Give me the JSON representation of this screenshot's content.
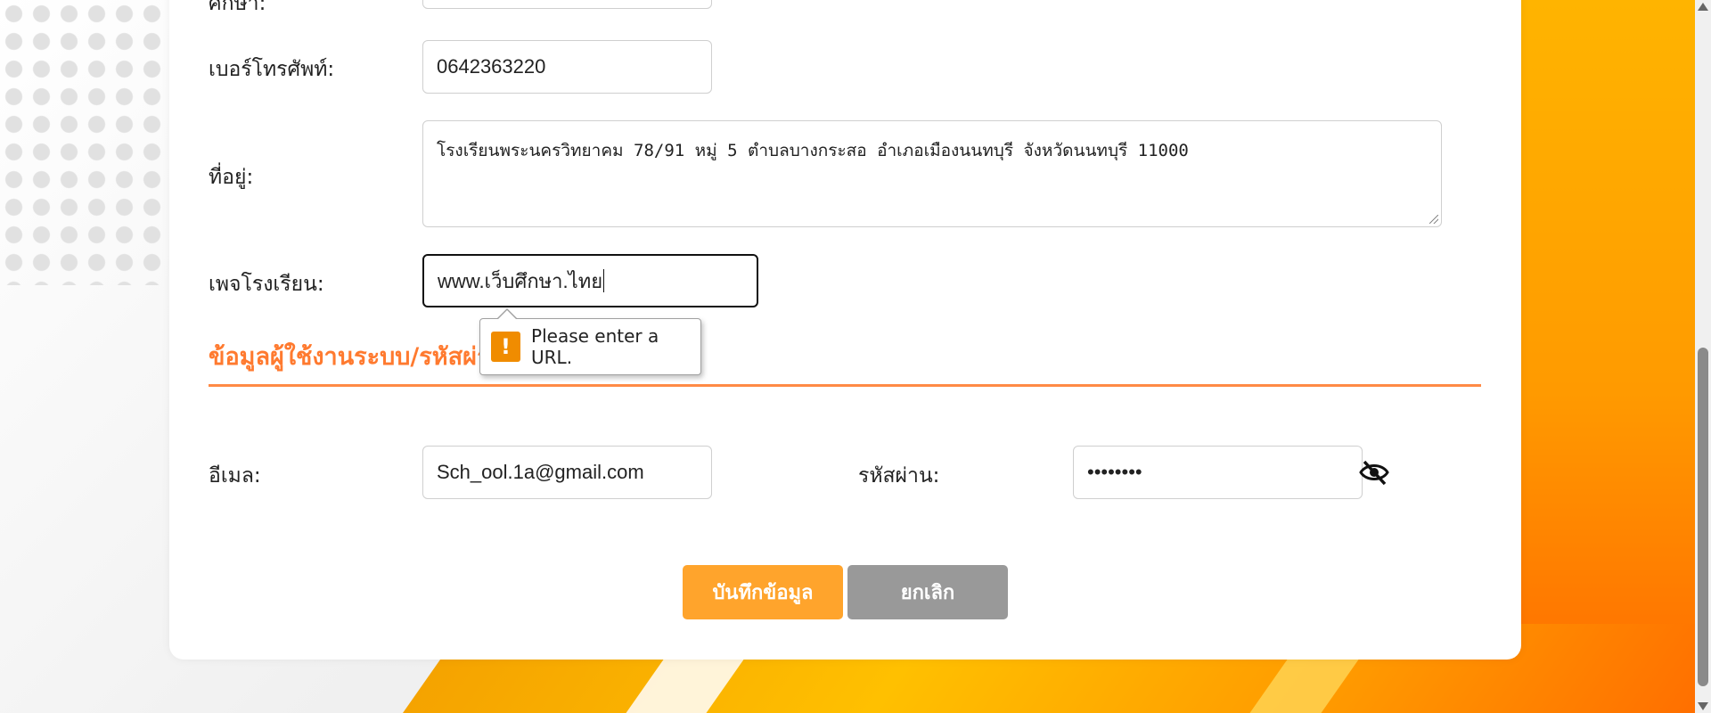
{
  "form": {
    "partial_label_top": "ศึกษา:",
    "phone": {
      "label": "เบอร์โทรศัพท์:",
      "value": "0642363220"
    },
    "address": {
      "label": "ที่อยู่:",
      "value": "โรงเรียนพระนครวิทยาคม 78/91 หมู่ 5 ตำบลบางกระสอ อำเภอเมืองนนทบุรี จังหวัดนนทบุรี 11000"
    },
    "school_page": {
      "label": "เพจโรงเรียน:",
      "value": "www.เว็บศึกษา.ไทย"
    },
    "section_title": "ข้อมูลผู้ใช้งานระบบ/รหัสผ่าน",
    "email": {
      "label": "อีเมล:",
      "value": "Sch_ool.1a@gmail.com"
    },
    "password": {
      "label": "รหัสผ่าน:",
      "value": "••••••••"
    }
  },
  "validation_tooltip": {
    "icon": "warning-icon",
    "message": "Please enter a URL."
  },
  "buttons": {
    "save": "บันทึกข้อมูล",
    "cancel": "ยกเลิก"
  },
  "colors": {
    "accent": "#ff7a2f",
    "save_button": "#ffa42c",
    "cancel_button": "#999999",
    "warning": "#f08c00"
  }
}
